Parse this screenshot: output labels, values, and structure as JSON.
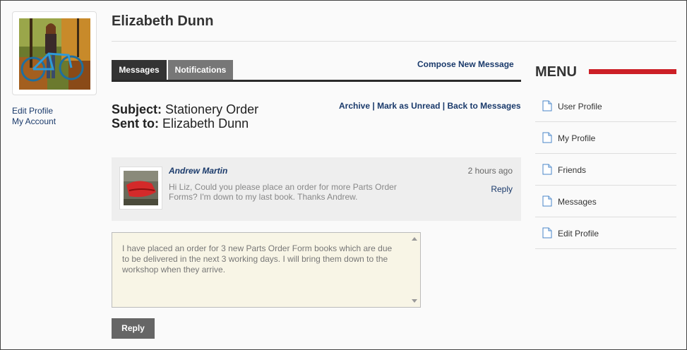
{
  "profile": {
    "name": "Elizabeth Dunn",
    "links": [
      "Edit Profile",
      "My Account"
    ]
  },
  "tabs": [
    {
      "label": "Messages",
      "active": true
    },
    {
      "label": "Notifications",
      "active": false
    }
  ],
  "compose_label": "Compose New Message",
  "message": {
    "subject_label": "Subject:",
    "subject": "Stationery Order",
    "sent_to_label": "Sent to:",
    "sent_to": "Elizabeth Dunn",
    "actions": [
      "Archive",
      "Mark as Unread",
      "Back to Messages"
    ]
  },
  "thread": {
    "sender": "Andrew Martin",
    "time": "2 hours ago",
    "body": "Hi Liz, Could you please place an order for more Parts Order Forms? I'm down to my last book. Thanks Andrew.",
    "reply_link": "Reply"
  },
  "reply": {
    "text": "I have placed an order for 3 new Parts Order Form books which are due to be delivered in the next 3 working days. I will bring them down to the workshop when they arrive.",
    "button_label": "Reply"
  },
  "menu": {
    "title": "MENU",
    "items": [
      {
        "label": "User Profile",
        "icon": "document-icon"
      },
      {
        "label": "My Profile",
        "icon": "document-icon"
      },
      {
        "label": "Friends",
        "icon": "document-icon"
      },
      {
        "label": "Messages",
        "icon": "document-icon"
      },
      {
        "label": "Edit Profile",
        "icon": "document-icon"
      }
    ]
  },
  "colors": {
    "accent_red": "#cc1f26",
    "link": "#1a3a6b",
    "active_tab": "#333333",
    "inactive_tab": "#777777",
    "reply_bg": "#f8f5e6"
  }
}
